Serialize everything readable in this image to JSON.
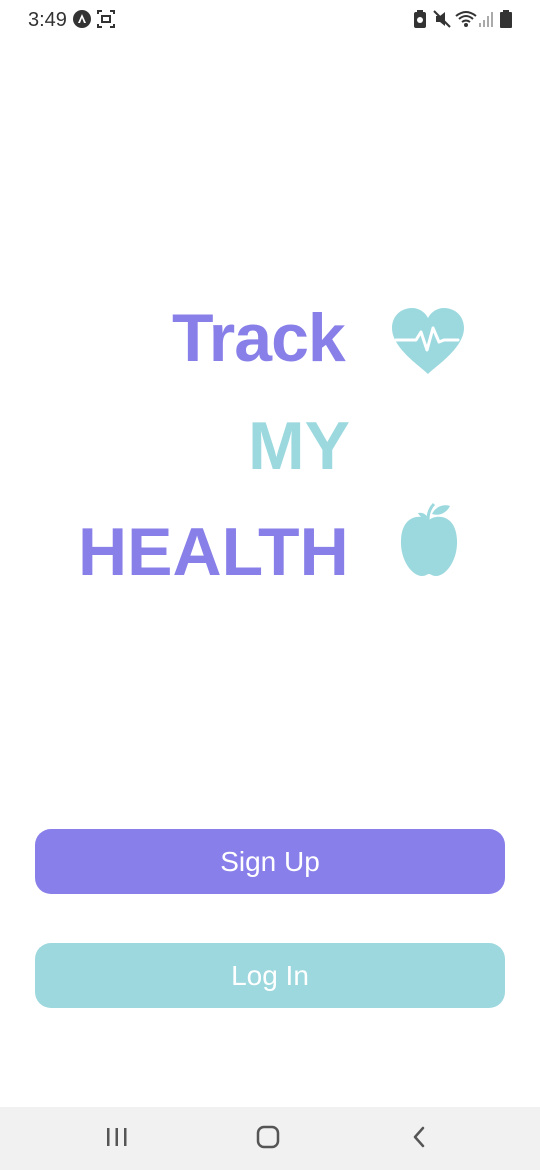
{
  "status_bar": {
    "time": "3:49",
    "left_icons": [
      "autocad-icon",
      "screenshot-icon"
    ],
    "right_icons": [
      "battery-saver-icon",
      "mute-icon",
      "wifi-icon",
      "signal-icon",
      "battery-icon"
    ]
  },
  "logo": {
    "line1": "Track",
    "line2": "MY",
    "line3": "HEALTH",
    "icon1": "heart-pulse-icon",
    "icon2": "apple-icon",
    "colors": {
      "purple": "#8880e8",
      "teal": "#9cd9df"
    }
  },
  "buttons": {
    "signup": "Sign Up",
    "login": "Log In",
    "colors": {
      "signup": "#887fea",
      "login": "#9dd8de"
    }
  },
  "nav_bar": {
    "icons": [
      "recent-apps-icon",
      "home-icon",
      "back-icon"
    ]
  }
}
